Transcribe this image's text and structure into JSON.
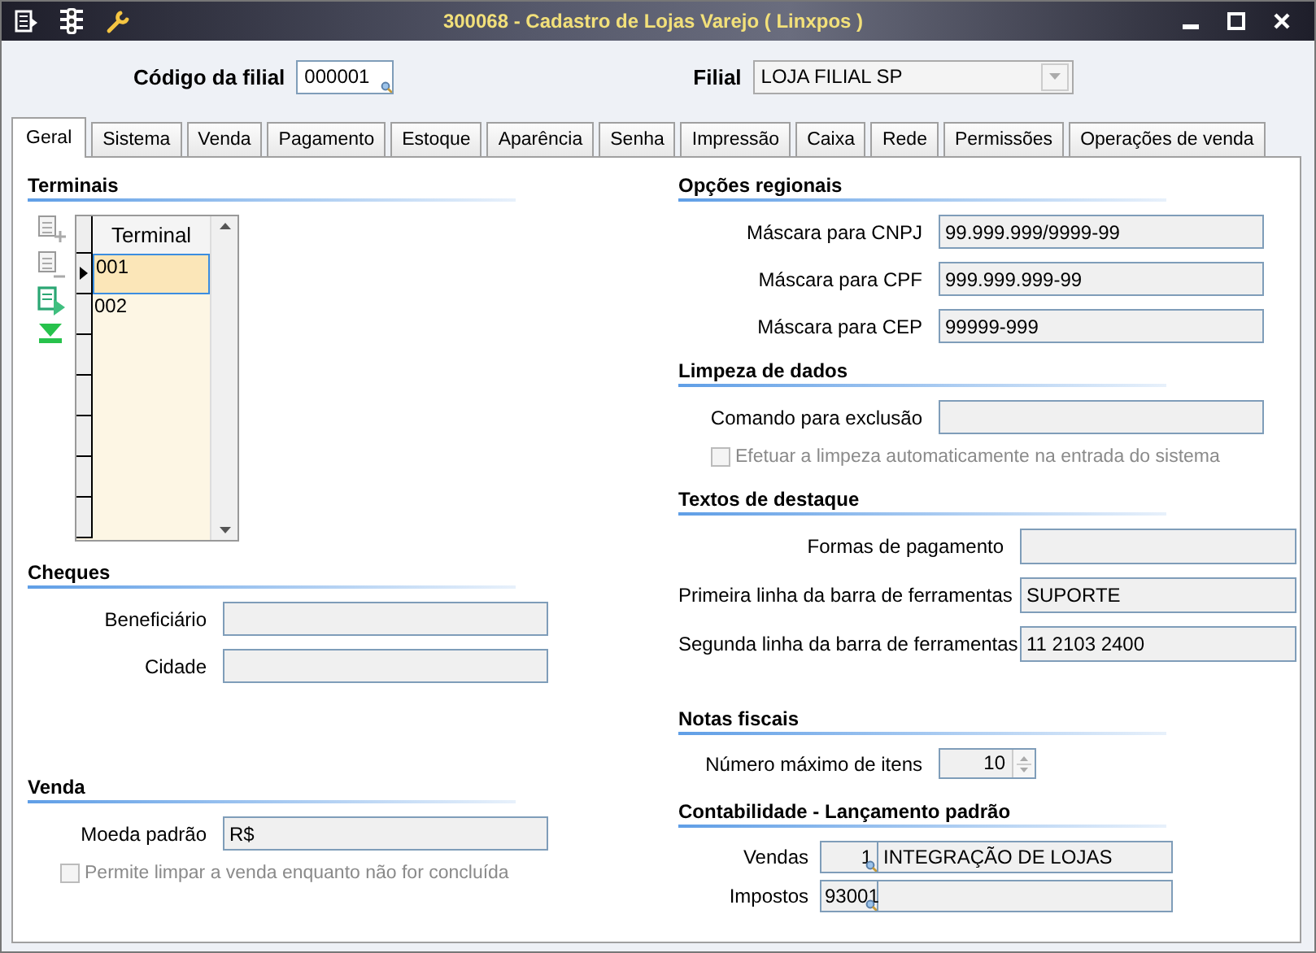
{
  "window": {
    "title": "300068 - Cadastro de Lojas Varejo ( Linxpos )"
  },
  "header": {
    "codigo": {
      "label": "Código da filial",
      "value": "000001"
    },
    "filial": {
      "label": "Filial",
      "value": "LOJA FILIAL SP",
      "disabled": true
    }
  },
  "tabs": [
    {
      "label": "Geral",
      "selected": true
    },
    {
      "label": "Sistema",
      "selected": false
    },
    {
      "label": "Venda",
      "selected": false
    },
    {
      "label": "Pagamento",
      "selected": false
    },
    {
      "label": "Estoque",
      "selected": false
    },
    {
      "label": "Aparência",
      "selected": false
    },
    {
      "label": "Senha",
      "selected": false
    },
    {
      "label": "Impressão",
      "selected": false
    },
    {
      "label": "Caixa",
      "selected": false
    },
    {
      "label": "Rede",
      "selected": false
    },
    {
      "label": "Permissões",
      "selected": false
    },
    {
      "label": "Operações de venda",
      "selected": false
    }
  ],
  "left": [
    {
      "kind": "grid",
      "title": "Terminais",
      "column": "Terminal",
      "rows": [
        {
          "value": "001",
          "selected": true
        },
        {
          "value": "002",
          "selected": false
        }
      ]
    },
    {
      "kind": "form",
      "title": "Cheques",
      "fields": [
        {
          "kind": "text",
          "label": "Beneficiário"
        },
        {
          "kind": "text",
          "label": "Cidade"
        }
      ]
    },
    {
      "kind": "form",
      "title": "Venda",
      "fields": [
        {
          "kind": "text",
          "label": "Moeda padrão",
          "value": "R$"
        }
      ],
      "checkbox": {
        "label": "Permite limpar a venda enquanto não for concluída",
        "checked": false,
        "disabled": true
      }
    }
  ],
  "right": [
    {
      "kind": "form",
      "title": "Opções regionais",
      "fields": [
        {
          "kind": "text",
          "label": "Máscara para CNPJ",
          "value": "99.999.999/9999-99"
        },
        {
          "kind": "text",
          "label": "Máscara para CPF",
          "value": "999.999.999-99"
        },
        {
          "kind": "text",
          "label": "Máscara para CEP",
          "value": "99999-999"
        }
      ]
    },
    {
      "kind": "form",
      "title": "Limpeza de dados",
      "fields": [
        {
          "kind": "text",
          "label": "Comando para exclusão"
        }
      ],
      "checkbox": {
        "label": "Efetuar a limpeza automaticamente na entrada do sistema",
        "checked": false,
        "disabled": true
      }
    },
    {
      "kind": "form",
      "title": "Textos de destaque",
      "fields": [
        {
          "kind": "text",
          "label": "Formas de pagamento"
        },
        {
          "kind": "text",
          "label": "Primeira linha da barra de ferramentas",
          "value": "SUPORTE"
        },
        {
          "kind": "text",
          "label": "Segunda linha da barra de ferramentas",
          "value": "11 2103 2400"
        }
      ]
    },
    {
      "kind": "form",
      "title": "Notas fiscais",
      "fields": [
        {
          "kind": "spin",
          "label": "Número máximo de itens",
          "value": "10"
        }
      ]
    },
    {
      "kind": "form",
      "title": "Contabilidade - Lançamento padrão",
      "fields": [
        {
          "kind": "lookup",
          "label": "Vendas",
          "code": "1",
          "value": "INTEGRAÇÃO DE LOJAS"
        },
        {
          "kind": "lookup",
          "label": "Impostos",
          "code": "93001"
        }
      ]
    }
  ]
}
